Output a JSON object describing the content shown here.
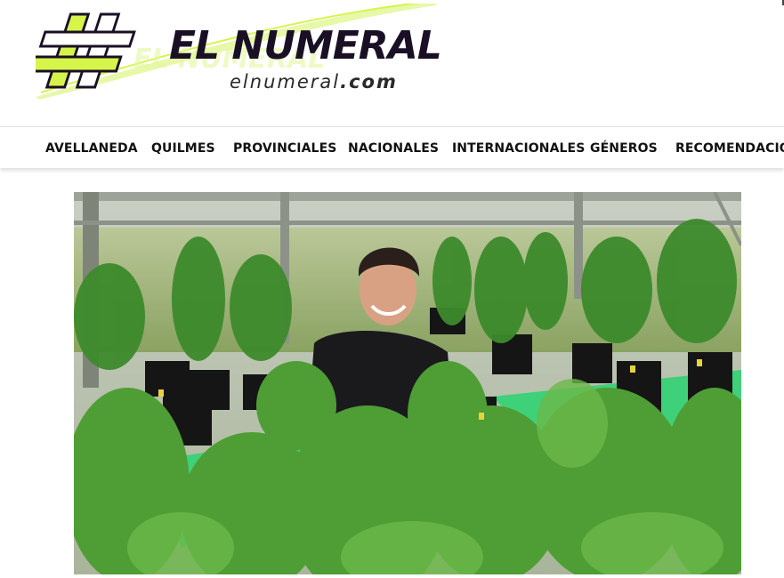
{
  "logo": {
    "title": "EL NUMERAL",
    "subtitle_main": "elnumeral",
    "subtitle_tld": ".com",
    "icon": "hash-icon"
  },
  "nav": {
    "items": [
      {
        "label": "AVELLANEDA"
      },
      {
        "label": "QUILMES"
      },
      {
        "label": "PROVINCIALES"
      },
      {
        "label": "NACIONALES"
      },
      {
        "label": "INTERNACIONALES"
      },
      {
        "label": "GÉNEROS"
      },
      {
        "label": "RECOMENDACIONES"
      }
    ]
  },
  "hero": {
    "subject": "man-in-greenhouse-photo"
  },
  "colors": {
    "accent_lime": "#d6f54a",
    "logo_dark": "#1a1026",
    "nav_text": "#111111"
  }
}
